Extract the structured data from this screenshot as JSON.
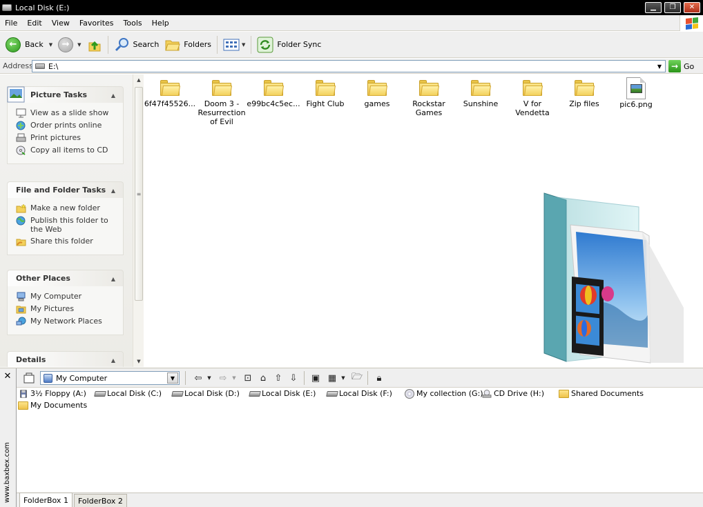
{
  "window": {
    "title": "Local Disk (E:)"
  },
  "menu": [
    "File",
    "Edit",
    "View",
    "Favorites",
    "Tools",
    "Help"
  ],
  "toolbar": {
    "back_label": "Back",
    "search_label": "Search",
    "folders_label": "Folders",
    "folder_sync_label": "Folder Sync"
  },
  "address": {
    "label": "Address",
    "value": "E:\\",
    "go_label": "Go"
  },
  "task_pane": {
    "picture_tasks": {
      "title": "Picture Tasks",
      "items": [
        "View as a slide show",
        "Order prints online",
        "Print pictures",
        "Copy all items to CD"
      ]
    },
    "file_folder_tasks": {
      "title": "File and Folder Tasks",
      "items": [
        "Make a new folder",
        "Publish this folder to the Web",
        "Share this folder"
      ]
    },
    "other_places": {
      "title": "Other Places",
      "items": [
        "My Computer",
        "My Pictures",
        "My Network Places"
      ]
    },
    "details": {
      "title": "Details"
    }
  },
  "files": [
    {
      "name": "6f47f45526...",
      "type": "folder"
    },
    {
      "name": "Doom 3 -\nResurrection\nof Evil",
      "type": "folder"
    },
    {
      "name": "e99bc4c5ec...",
      "type": "folder"
    },
    {
      "name": "Fight Club",
      "type": "folder"
    },
    {
      "name": "games",
      "type": "folder"
    },
    {
      "name": "Rockstar\nGames",
      "type": "folder"
    },
    {
      "name": "Sunshine",
      "type": "folder"
    },
    {
      "name": "V for Vendetta",
      "type": "folder"
    },
    {
      "name": "Zip files",
      "type": "folder"
    },
    {
      "name": "pic6.png",
      "type": "image"
    }
  ],
  "folderbox": {
    "location": "My Computer",
    "drives": [
      {
        "label": "3½ Floppy (A:)",
        "icon": "floppy-icon"
      },
      {
        "label": "Local Disk (C:)",
        "icon": "hard-drive-icon"
      },
      {
        "label": "Local Disk (D:)",
        "icon": "hard-drive-icon"
      },
      {
        "label": "Local Disk (E:)",
        "icon": "hard-drive-icon"
      },
      {
        "label": "Local Disk (F:)",
        "icon": "hard-drive-icon"
      },
      {
        "label": "My collection (G:)",
        "icon": "cd-icon"
      },
      {
        "label": "CD Drive (H:)",
        "icon": "cd-drive-icon"
      },
      {
        "label": "Shared Documents",
        "icon": "folder-icon"
      },
      {
        "label": "My Documents",
        "icon": "folder-icon"
      }
    ],
    "side_text": "www.baxbex.com",
    "tabs": [
      "FolderBox 1",
      "FolderBox 2"
    ]
  },
  "colors": {
    "titlebar": "#000000",
    "chrome": "#efefef",
    "folder": "#f3d15c",
    "go_green": "#2a9418"
  }
}
